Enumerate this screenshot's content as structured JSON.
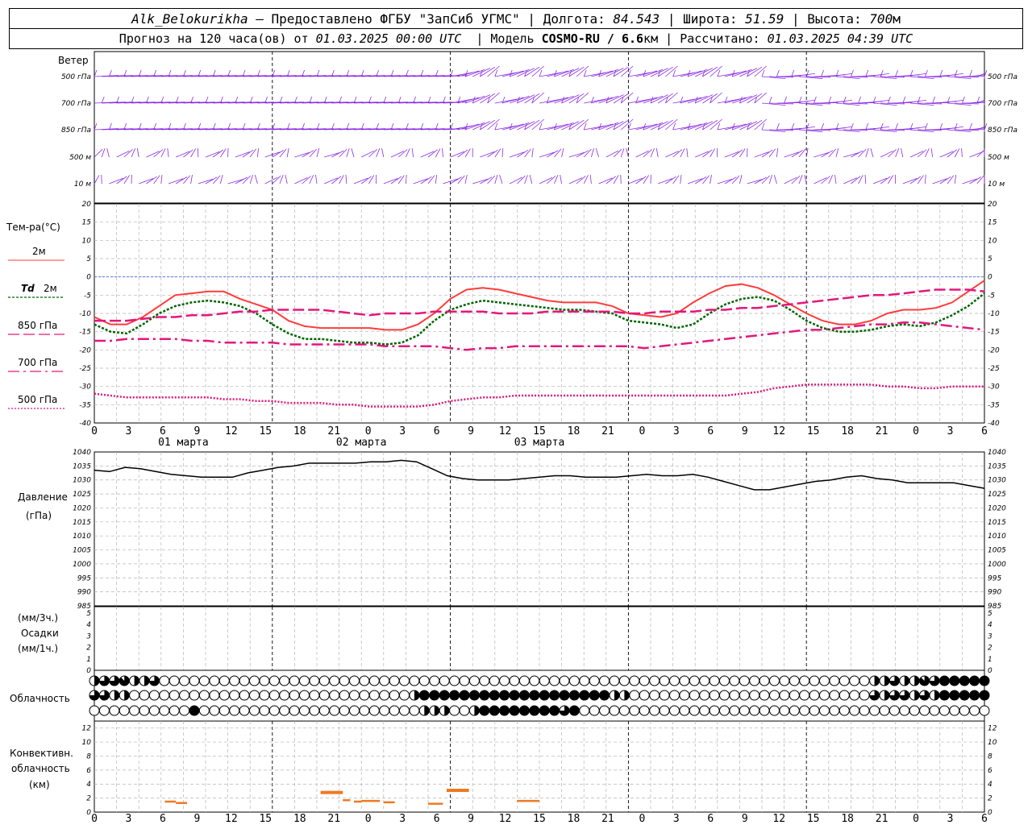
{
  "header": {
    "station": "Alk_Belokurikha",
    "provider": " – Предоставлено ФГБУ \"ЗапСиб УГМС\" | Долгота: ",
    "lon": "84.543",
    "lat_label": " | Широта: ",
    "lat": "51.59",
    "alt_label": " | Высота: ",
    "alt": "700",
    "alt_unit": "м",
    "fc_label": "Прогноз на 120 часа(ов) от ",
    "fc_time": "01.03.2025 00:00 UTC",
    "model_label": "  | Модель ",
    "model": "COSMO-RU / 6.6",
    "model_unit": "км",
    "calc_label": " | Рассчитано: ",
    "calc_time": "01.03.2025 04:39 UTC"
  },
  "labels": {
    "wind": "Ветер",
    "wind_levels": [
      "500 гПа",
      "700 гПа",
      "850 гПа",
      "500 м",
      "10 м"
    ],
    "temp": "Тем-ра(°С)",
    "t2m": "2м",
    "td": "Td",
    "td2m": "2м",
    "t850": "850 гПа",
    "t700": "700 гПа",
    "t500": "500 гПа",
    "pressure": "Давление",
    "pressure_unit": "(гПа)",
    "precip_3h": "(мм/3ч.)",
    "precip": "Осадки",
    "precip_1h": "(мм/1ч.)",
    "cloud": "Облачность",
    "conv1": "Конвективн.",
    "conv2": "облачность",
    "conv3": "(км)"
  },
  "colors": {
    "wind": "#8a2be2",
    "t2m": "#ff3b3b",
    "td": "#006400",
    "t850": "#e3177c",
    "t700": "#e3177c",
    "t500": "#e3177c",
    "zero": "#4169e1",
    "pressure": "#000000",
    "conv": "#f07820",
    "grid": "#b5b5b5"
  },
  "chart_data": {
    "type": "line",
    "x_hours_tick_labels": [
      "0",
      "3",
      "6",
      "9",
      "12",
      "15",
      "18",
      "21",
      "0",
      "3",
      "6",
      "9",
      "12",
      "15",
      "18",
      "21",
      "0",
      "3",
      "6",
      "9",
      "12",
      "15",
      "18",
      "21",
      "0",
      "3",
      "6"
    ],
    "days": [
      "01 марта",
      "02 марта",
      "03 марта"
    ],
    "temperature": {
      "ylim": [
        -40,
        20
      ],
      "yticks": [
        20,
        15,
        10,
        5,
        0,
        -5,
        -10,
        -15,
        -20,
        -25,
        -30,
        -35,
        -40
      ],
      "series": [
        {
          "name": "2м",
          "values": [
            -11,
            -13,
            -13,
            -11,
            -8,
            -5,
            -4.5,
            -4,
            -4,
            -6,
            -7.5,
            -9,
            -12,
            -13.5,
            -14,
            -14,
            -14,
            -14,
            -14.5,
            -14.5,
            -13,
            -10,
            -6,
            -3.5,
            -3,
            -3.5,
            -4.5,
            -5.5,
            -6.5,
            -7,
            -7,
            -7,
            -8,
            -10,
            -10.5,
            -11,
            -10,
            -7,
            -4.5,
            -2.5,
            -2,
            -3,
            -5,
            -7.5,
            -10,
            -12,
            -13,
            -13,
            -12,
            -10,
            -9,
            -9,
            -8.5,
            -7,
            -4,
            -1
          ]
        },
        {
          "name": "Td 2м",
          "values": [
            -13,
            -15,
            -15.5,
            -13,
            -10,
            -8,
            -7,
            -6.5,
            -7,
            -8,
            -10,
            -13,
            -15.5,
            -17,
            -17,
            -17.5,
            -18,
            -18,
            -18.5,
            -18,
            -16,
            -12,
            -9,
            -7.5,
            -6.5,
            -7,
            -7.5,
            -8,
            -8.5,
            -9,
            -9,
            -9.5,
            -10,
            -12,
            -12.5,
            -13,
            -14,
            -13,
            -10,
            -7.5,
            -6,
            -5.5,
            -6.5,
            -9,
            -12,
            -14,
            -15,
            -15,
            -14.5,
            -13.5,
            -13,
            -13.5,
            -12.5,
            -10.5,
            -8,
            -4.5
          ]
        },
        {
          "name": "850 гПа",
          "values": [
            -12,
            -12,
            -12,
            -11.5,
            -11,
            -11,
            -10.5,
            -10.5,
            -10,
            -9.5,
            -9.5,
            -9,
            -9,
            -9,
            -9,
            -9.5,
            -10,
            -10.5,
            -10,
            -10,
            -10,
            -9.5,
            -9.5,
            -9.5,
            -9.5,
            -10,
            -10,
            -10,
            -9.5,
            -9.5,
            -9.5,
            -9.5,
            -9.5,
            -10,
            -10,
            -9.5,
            -9.5,
            -9.5,
            -9,
            -9,
            -8.5,
            -8.5,
            -8,
            -7.5,
            -7,
            -6.5,
            -6,
            -5.5,
            -5,
            -5,
            -4.5,
            -4,
            -3.5,
            -3.5,
            -3.5,
            -4
          ]
        },
        {
          "name": "700 гПа",
          "values": [
            -17.5,
            -17.5,
            -17,
            -17,
            -17,
            -17,
            -17.5,
            -17.5,
            -18,
            -18,
            -18,
            -18,
            -18.5,
            -18.5,
            -18.5,
            -18.5,
            -18.5,
            -18.5,
            -19,
            -19,
            -19,
            -19,
            -19.5,
            -20,
            -19.5,
            -19.5,
            -19,
            -19,
            -19,
            -19,
            -19,
            -19,
            -19,
            -19,
            -19.5,
            -19,
            -18.5,
            -18,
            -17.5,
            -17,
            -16.5,
            -16,
            -15.5,
            -15,
            -14.5,
            -14.5,
            -14,
            -13.5,
            -13,
            -13,
            -12.5,
            -12.5,
            -13,
            -13.5,
            -14,
            -14.5
          ]
        },
        {
          "name": "500 гПа",
          "values": [
            -32,
            -32.5,
            -33,
            -33,
            -33,
            -33,
            -33,
            -33,
            -33.5,
            -33.5,
            -34,
            -34,
            -34.5,
            -34.5,
            -34.5,
            -35,
            -35,
            -35.5,
            -35.5,
            -35.5,
            -35.5,
            -35,
            -34,
            -33.5,
            -33,
            -33,
            -32.5,
            -32.5,
            -32.5,
            -32.5,
            -32.5,
            -32.5,
            -32.5,
            -32.5,
            -32.5,
            -32.5,
            -32.5,
            -32.5,
            -32.5,
            -32.5,
            -32,
            -31.5,
            -30.5,
            -30,
            -29.5,
            -29.5,
            -29.5,
            -29.5,
            -29.5,
            -30,
            -30,
            -30.5,
            -30.5,
            -30,
            -30,
            -30
          ]
        }
      ]
    },
    "pressure": {
      "ylim": [
        985,
        1040
      ],
      "yticks": [
        1040,
        1035,
        1030,
        1025,
        1020,
        1015,
        1010,
        1005,
        1000,
        995,
        990,
        985
      ],
      "values": [
        1033.5,
        1033,
        1034.5,
        1034,
        1033,
        1032,
        1031.5,
        1031,
        1031,
        1031,
        1032.5,
        1033.5,
        1034.5,
        1035,
        1036,
        1036,
        1036,
        1036,
        1036.5,
        1036.5,
        1037,
        1036.5,
        1034,
        1031.5,
        1030.5,
        1030,
        1030,
        1030,
        1030.5,
        1031,
        1031.5,
        1031.5,
        1031,
        1031,
        1031,
        1031.5,
        1032,
        1031.5,
        1031.5,
        1032,
        1031,
        1029.5,
        1028,
        1026.5,
        1026.5,
        1027.5,
        1028.5,
        1029.5,
        1030,
        1031,
        1031.5,
        1030.5,
        1030,
        1029,
        1029,
        1029,
        1029,
        1028,
        1027
      ]
    },
    "precip": {
      "ylim": [
        0,
        5
      ],
      "yticks": [
        5,
        4,
        3,
        2,
        1,
        0
      ],
      "values": []
    },
    "cloud": {
      "cover_rows_eighths": [
        [
          4,
          6,
          6,
          7,
          4,
          4,
          6,
          0,
          0,
          0,
          0,
          0,
          0,
          0,
          0,
          0,
          0,
          0,
          0,
          0,
          0,
          0,
          0,
          0,
          0,
          0,
          0,
          0,
          0,
          0,
          0,
          0,
          0,
          0,
          0,
          0,
          0,
          0,
          0,
          0,
          0,
          0,
          0,
          0,
          0,
          0,
          0,
          0,
          0,
          0,
          0,
          0,
          0,
          0,
          0,
          0,
          0,
          0,
          0,
          0,
          0,
          0,
          0,
          0,
          0,
          0,
          0,
          0,
          0,
          0,
          0,
          0,
          0,
          0,
          0,
          0,
          0,
          0,
          4,
          4,
          6,
          4,
          4,
          7,
          6,
          8,
          8,
          8,
          8,
          8
        ],
        [
          6,
          6,
          4,
          4,
          0,
          0,
          0,
          0,
          0,
          0,
          0,
          0,
          0,
          0,
          0,
          0,
          0,
          0,
          0,
          0,
          0,
          0,
          0,
          0,
          0,
          0,
          0,
          0,
          0,
          0,
          0,
          0,
          4,
          8,
          8,
          8,
          8,
          8,
          8,
          8,
          8,
          8,
          8,
          8,
          8,
          8,
          8,
          8,
          8,
          8,
          8,
          8,
          4,
          4,
          0,
          0,
          0,
          0,
          0,
          0,
          0,
          0,
          0,
          0,
          0,
          0,
          0,
          0,
          0,
          0,
          0,
          0,
          0,
          0,
          0,
          0,
          0,
          0,
          6,
          4,
          6,
          6,
          4,
          6,
          4,
          8,
          8,
          8,
          8,
          8
        ],
        [
          0,
          0,
          0,
          0,
          0,
          0,
          0,
          0,
          0,
          0,
          8,
          0,
          0,
          0,
          0,
          0,
          0,
          0,
          0,
          0,
          0,
          0,
          0,
          0,
          0,
          0,
          0,
          0,
          0,
          0,
          0,
          0,
          0,
          4,
          4,
          4,
          0,
          0,
          4,
          8,
          8,
          8,
          8,
          8,
          8,
          8,
          8,
          6,
          8,
          0,
          0,
          0,
          0,
          0,
          0,
          0,
          0,
          0,
          0,
          0,
          0,
          0,
          0,
          0,
          0,
          0,
          0,
          0,
          0,
          0,
          0,
          0,
          0,
          0,
          0,
          0,
          0,
          0,
          0,
          0,
          0,
          0,
          0,
          0,
          0,
          0,
          0,
          0,
          0,
          0
        ]
      ]
    },
    "convective": {
      "ylim": [
        0,
        13
      ],
      "yticks": [
        12,
        10,
        8,
        6,
        4,
        2,
        0
      ],
      "segments": [
        {
          "h0": 9.5,
          "h1": 11,
          "km": 1.5
        },
        {
          "h0": 11,
          "h1": 12.5,
          "km": 1.3
        },
        {
          "h0": 30.5,
          "h1": 33.5,
          "km": 2.8
        },
        {
          "h0": 33.5,
          "h1": 34.5,
          "km": 1.7
        },
        {
          "h0": 35,
          "h1": 36,
          "km": 1.5
        },
        {
          "h0": 36,
          "h1": 38.5,
          "km": 1.6
        },
        {
          "h0": 39,
          "h1": 40.5,
          "km": 1.4
        },
        {
          "h0": 45,
          "h1": 47,
          "km": 1.2
        },
        {
          "h0": 47.5,
          "h1": 50.5,
          "km": 3.1
        },
        {
          "h0": 57,
          "h1": 60,
          "km": 1.6
        }
      ]
    }
  }
}
